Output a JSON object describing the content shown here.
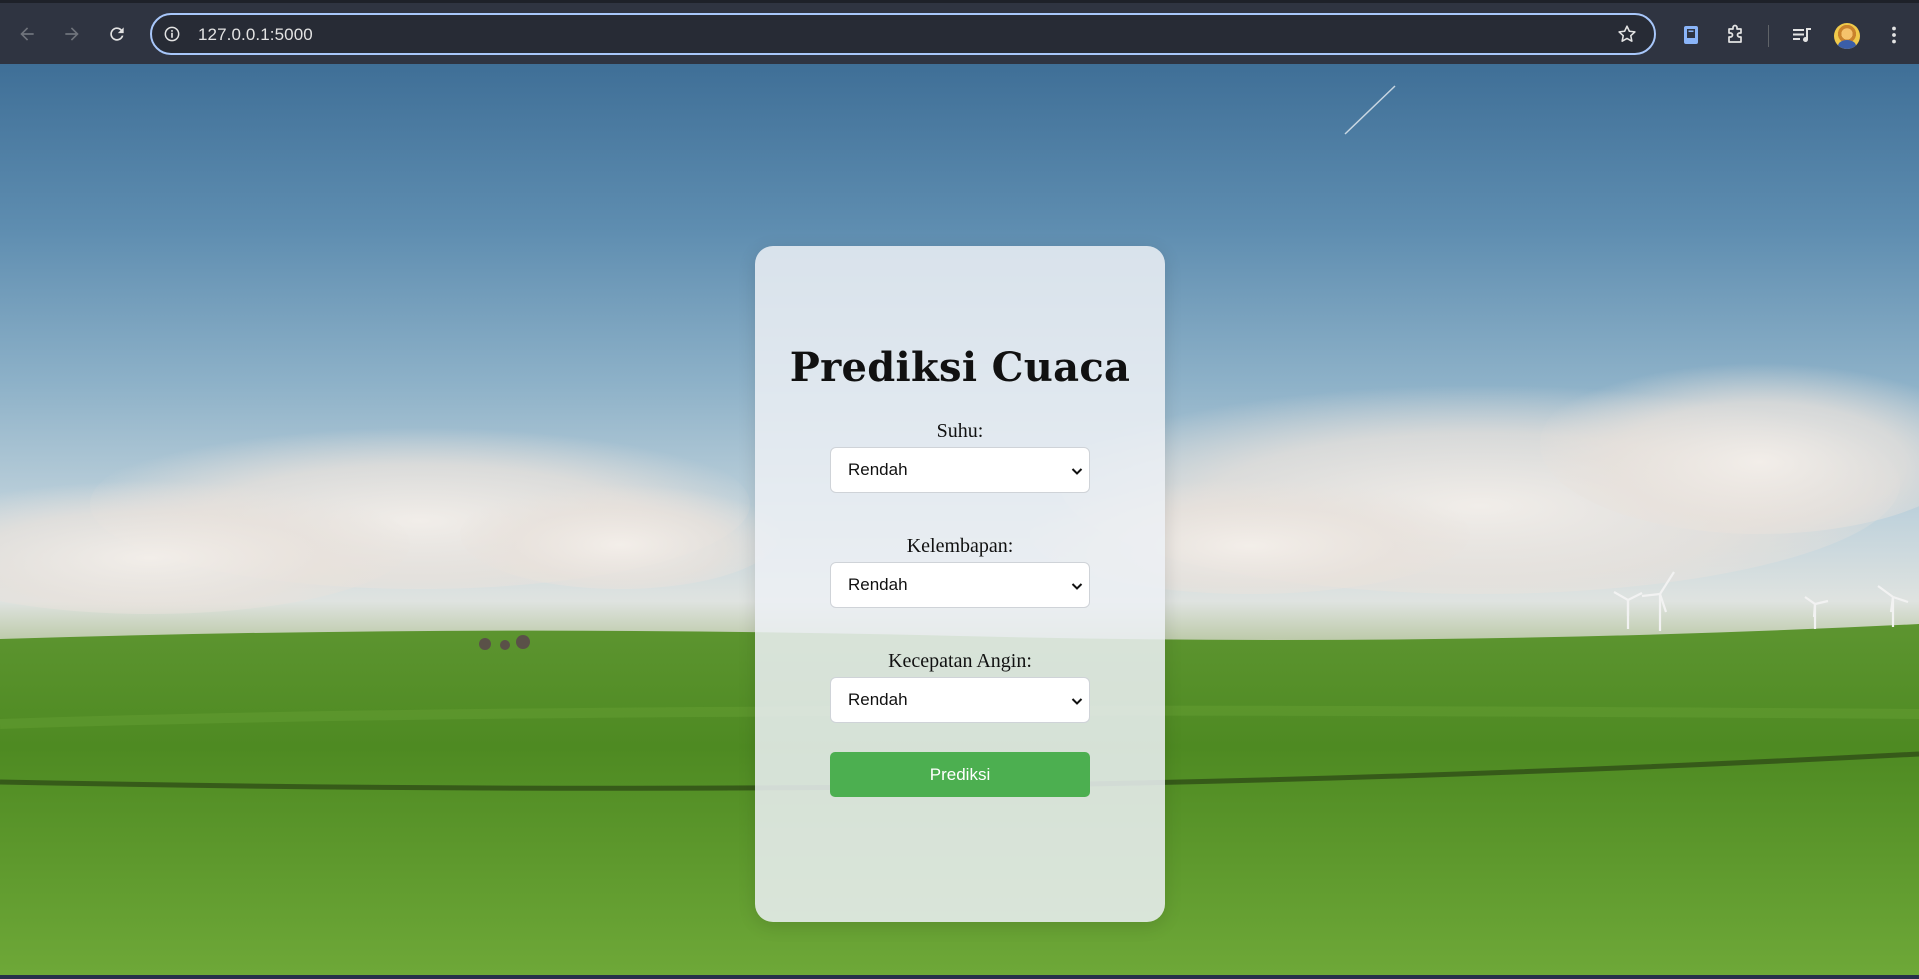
{
  "browser": {
    "url": "127.0.0.1:5000"
  },
  "form": {
    "title": "Prediksi Cuaca",
    "fields": [
      {
        "label": "Suhu:",
        "value": "Rendah"
      },
      {
        "label": "Kelembapan:",
        "value": "Rendah"
      },
      {
        "label": "Kecepatan Angin:",
        "value": "Rendah"
      }
    ],
    "submit_label": "Prediksi"
  },
  "colors": {
    "submit_button": "#4caf50",
    "chrome_background": "#2f3441",
    "omnibox_border": "#a8c7fa"
  },
  "icons": {
    "back": "arrow-left-icon",
    "forward": "arrow-right-icon",
    "reload": "reload-icon",
    "site_info": "info-icon",
    "bookmark": "star-icon",
    "reading": "book-icon",
    "extensions": "puzzle-icon",
    "media": "media-queue-icon",
    "menu": "kebab-menu-icon"
  }
}
